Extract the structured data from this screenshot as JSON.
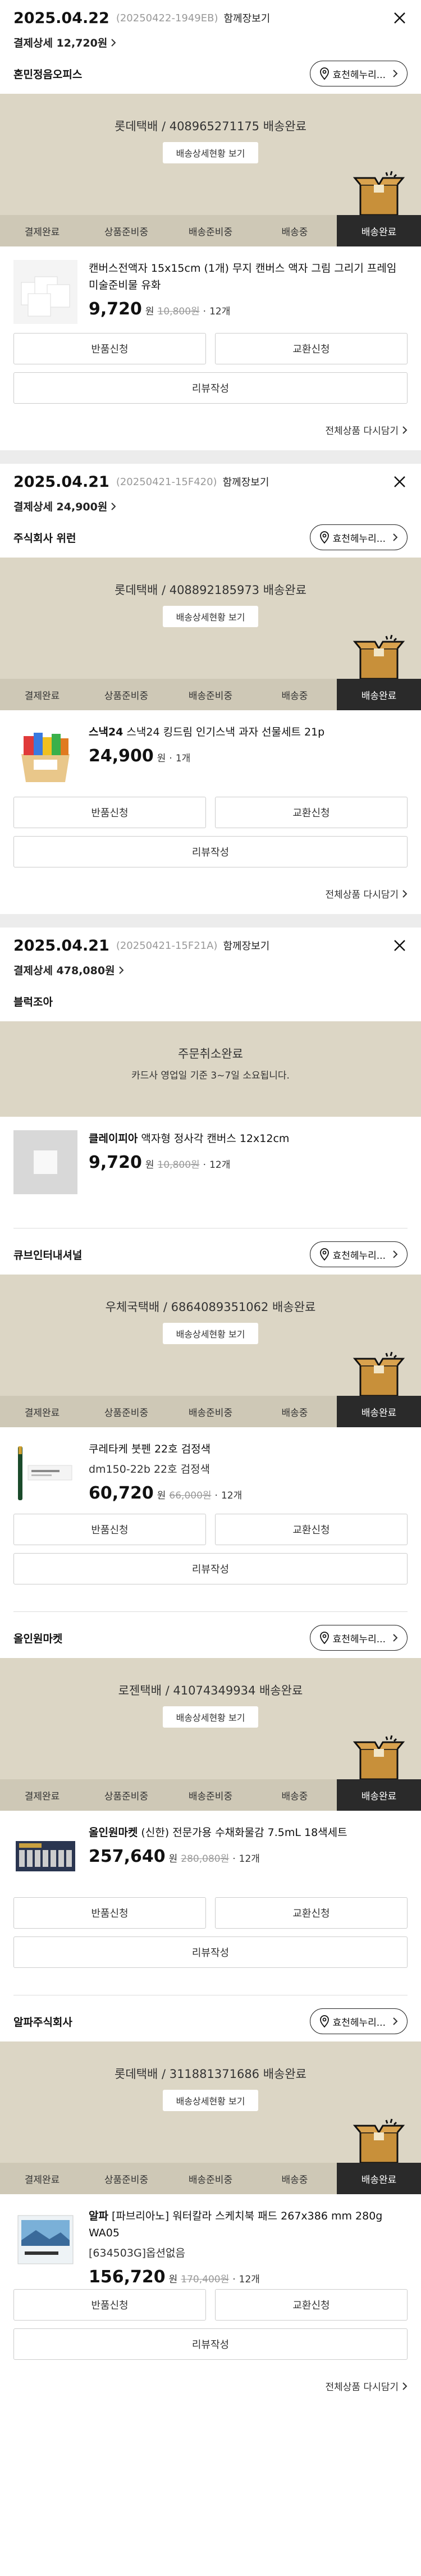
{
  "orders": [
    {
      "date": "2025.04.22",
      "order_no": "(20250422-1949EB)",
      "bulk_label": "함께장보기",
      "payment": "결제상세 12,720원",
      "groups": [
        {
          "seller": "혼민정음오피스",
          "store_label": "효천헤누리...",
          "status_type": "tabs",
          "status_text": "롯데택배 / 408965271175 배송완료",
          "status_button": "배송상세현황 보기",
          "product": {
            "thumb": "canvas-pack",
            "brand": "",
            "name": "캔버스전액자 15x15cm (1개) 무지 캔버스 액자 그림 그리기 프레임 미술준비물 유화",
            "option": "",
            "price": "9,720",
            "won": "원",
            "original": "10,800원",
            "qty": "12개"
          },
          "show_actions": true,
          "show_reorder": true
        }
      ]
    },
    {
      "date": "2025.04.21",
      "order_no": "(20250421-15F420)",
      "bulk_label": "함께장보기",
      "payment": "결제상세 24,900원",
      "groups": [
        {
          "seller": "주식회사 위런",
          "store_label": "효천헤누리...",
          "status_type": "tabs",
          "status_text": "롯데택배 / 408892185973 배송완료",
          "status_button": "배송상세현황 보기",
          "product": {
            "thumb": "snack-box",
            "brand": "스낵24",
            "name": "스낵24 킹드림 인기스낵 과자 선물세트 21p",
            "option": "",
            "price": "24,900",
            "won": "원",
            "original": "",
            "qty": "1개"
          },
          "show_actions": true,
          "show_reorder": true
        }
      ]
    },
    {
      "date": "2025.04.21",
      "order_no": "(20250421-15F21A)",
      "bulk_label": "함께장보기",
      "payment": "결제상세 478,080원",
      "groups": [
        {
          "seller": "블럭조아",
          "store_label": "",
          "status_type": "cancel",
          "status_text": "주문취소완료",
          "status_sub": "카드사 영업일 기준 3~7일 소요됩니다.",
          "product": {
            "thumb": "white-canvas",
            "brand": "클레이피아",
            "name": "액자형 정사각 캔버스 12x12cm",
            "option": "",
            "price": "9,720",
            "won": "원",
            "original": "10,800원",
            "qty": "12개"
          },
          "show_actions": false,
          "show_reorder": false
        },
        {
          "seller": "큐브인터내셔널",
          "store_label": "효천헤누리...",
          "status_type": "tabs",
          "status_text": "우체국택배 / 6864089351062 배송완료",
          "status_button": "배송상세현황 보기",
          "product": {
            "thumb": "pen",
            "brand": "",
            "name": "쿠레타케 붓펜 22호 검정색",
            "option": "dm150-22b 22호 검정색",
            "price": "60,720",
            "won": "원",
            "original": "66,000원",
            "qty": "12개"
          },
          "show_actions": true,
          "show_reorder": false
        },
        {
          "seller": "올인원마켓",
          "store_label": "효천헤누리...",
          "status_type": "tabs",
          "status_text": "로젠택배 / 41074349934 배송완료",
          "status_button": "배송상세현황 보기",
          "product": {
            "thumb": "paint-set",
            "brand": "올인원마켓",
            "name": "(신한) 전문가용 수채화물감 7.5mL 18색세트",
            "option": "",
            "price": "257,640",
            "won": "원",
            "original": "280,080원",
            "qty": "12개"
          },
          "show_actions": true,
          "show_reorder": false
        },
        {
          "seller": "알파주식회사",
          "store_label": "효천헤누리...",
          "status_type": "tabs",
          "status_text": "롯데택배 / 311881371686 배송완료",
          "status_button": "배송상세현황 보기",
          "product": {
            "thumb": "sketchbook",
            "brand": "알파",
            "name": "[파브리아노] 워터칼라 스케치북 패드 267x386 mm 280g WA05",
            "option": "[634503G]옵션없음",
            "price": "156,720",
            "won": "원",
            "original": "170,400원",
            "qty": "12개"
          },
          "show_actions": true,
          "show_reorder": true
        }
      ]
    }
  ],
  "tabs": [
    "결제완료",
    "상품준비중",
    "배송준비중",
    "배송중",
    "배송완료"
  ],
  "actions": {
    "return": "반품신청",
    "exchange": "교환신청",
    "review": "리뷰작성",
    "reorder": "전체상품 다시담기"
  },
  "icons": {
    "close": "close-icon",
    "store": "location-pin-icon",
    "chevron": "chevron-right-icon",
    "box": "delivered-box-icon"
  },
  "colors": {
    "status_bg": "#dcd6c5",
    "tabs_bg": "#cec8b6",
    "active_tab": "#2a2a2a",
    "separator": "#ececec"
  }
}
